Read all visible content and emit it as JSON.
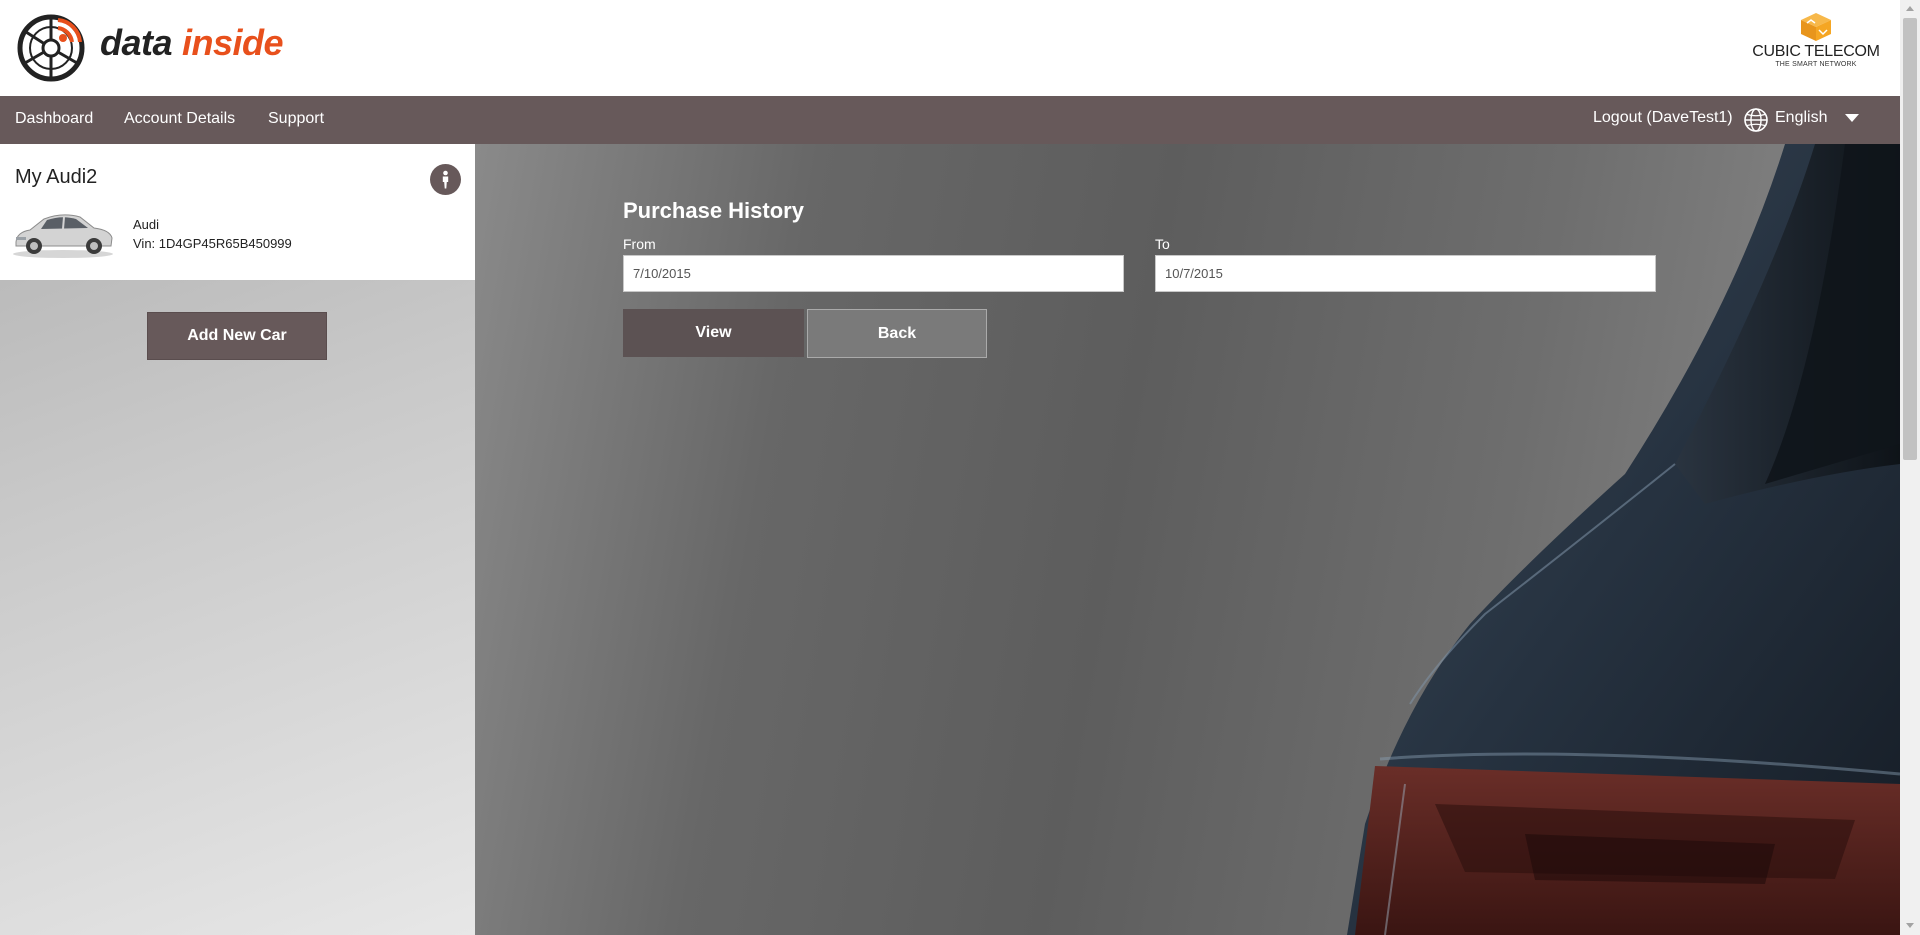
{
  "brand": {
    "part1": "data",
    "part2": "inside",
    "logo_icon": "speedometer-signal-icon"
  },
  "partner": {
    "name": "CUBIC TELECOM",
    "tagline": "THE SMART NETWORK",
    "icon": "cube-icon"
  },
  "nav": {
    "items": [
      {
        "label": "Dashboard"
      },
      {
        "label": "Account Details"
      },
      {
        "label": "Support"
      }
    ],
    "logout": "Logout (DaveTest1)",
    "language": "English",
    "language_icon": "globe-icon",
    "dropdown_icon": "caret-down-icon"
  },
  "sidebar": {
    "car": {
      "name": "My Audi2",
      "make": "Audi",
      "vin": "Vin: 1D4GP45R65B450999",
      "info_icon": "info-icon"
    },
    "add_car_label": "Add New Car"
  },
  "main": {
    "title": "Purchase History",
    "from_label": "From",
    "from_value": "7/10/2015",
    "to_label": "To",
    "to_value": "10/7/2015",
    "view_label": "View",
    "back_label": "Back"
  },
  "colors": {
    "nav_bg": "#67595a",
    "brand_accent": "#e8501c",
    "partner_accent": "#f5a623"
  }
}
